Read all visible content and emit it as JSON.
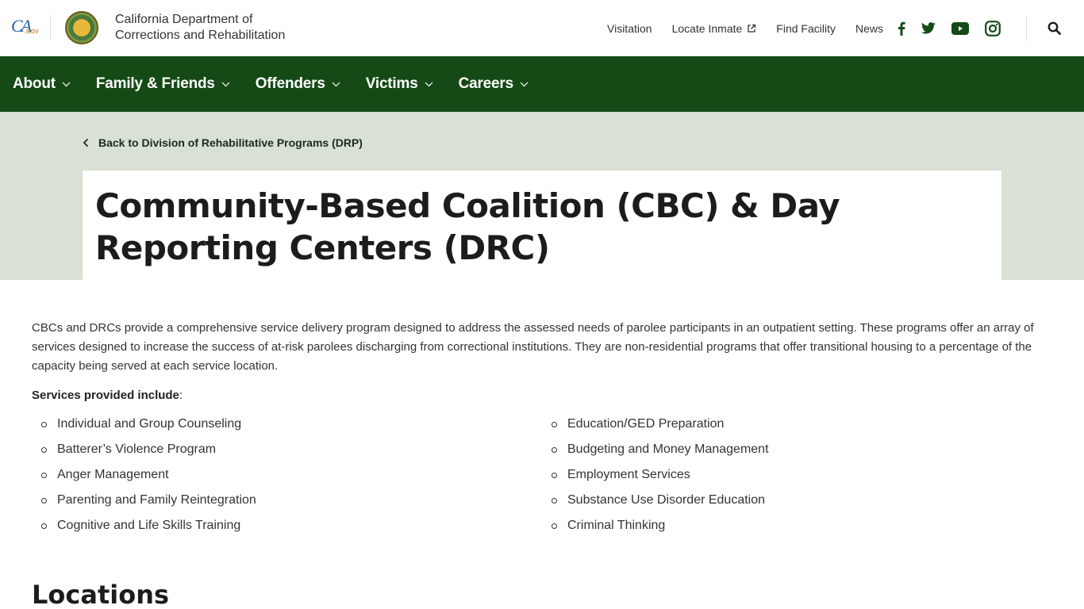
{
  "header": {
    "cagov_logo": {
      "ca": "CA",
      "gov": ".GOV"
    },
    "department_line1": "California Department of",
    "department_line2": "Corrections and Rehabilitation",
    "links": [
      {
        "label": "Visitation"
      },
      {
        "label": "Locate Inmate",
        "icon": "external-link-icon"
      },
      {
        "label": "Find Facility"
      },
      {
        "label": "News"
      }
    ],
    "social": [
      "facebook-icon",
      "twitter-icon",
      "youtube-icon",
      "instagram-icon"
    ],
    "search_icon": "search-icon"
  },
  "nav": {
    "items": [
      {
        "label": "About"
      },
      {
        "label": "Family & Friends"
      },
      {
        "label": "Offenders"
      },
      {
        "label": "Victims"
      },
      {
        "label": "Careers"
      }
    ]
  },
  "banner": {
    "back_link": "Back to Division of Rehabilitative Programs (DRP)",
    "title_line1": "Community-Based Coalition (CBC) & Day",
    "title_line2": "Reporting Centers (DRC)"
  },
  "content": {
    "intro": "CBCs and DRCs provide a comprehensive service delivery program designed to address the assessed needs of parolee participants in an outpatient setting. These programs offer an array of services designed to increase the success of at-risk parolees discharging from correctional institutions. They are non-residential programs that offer transitional housing to a percentage of the capacity being served at each service location.",
    "services_label": "Services provided include",
    "services_colon": ":",
    "services_left": [
      "Individual and Group Counseling",
      "Batterer’s Violence Program",
      "Anger Management",
      "Parenting and Family Reintegration",
      "Cognitive and Life Skills Training"
    ],
    "services_right": [
      "Education/GED Preparation",
      "Budgeting and Money Management",
      "Employment Services",
      "Substance Use Disorder Education",
      "Criminal Thinking"
    ],
    "locations_heading": "Locations"
  },
  "colors": {
    "nav_green": "#154a17",
    "banner_bg": "#d8e1d3",
    "social_green": "#154a17"
  }
}
